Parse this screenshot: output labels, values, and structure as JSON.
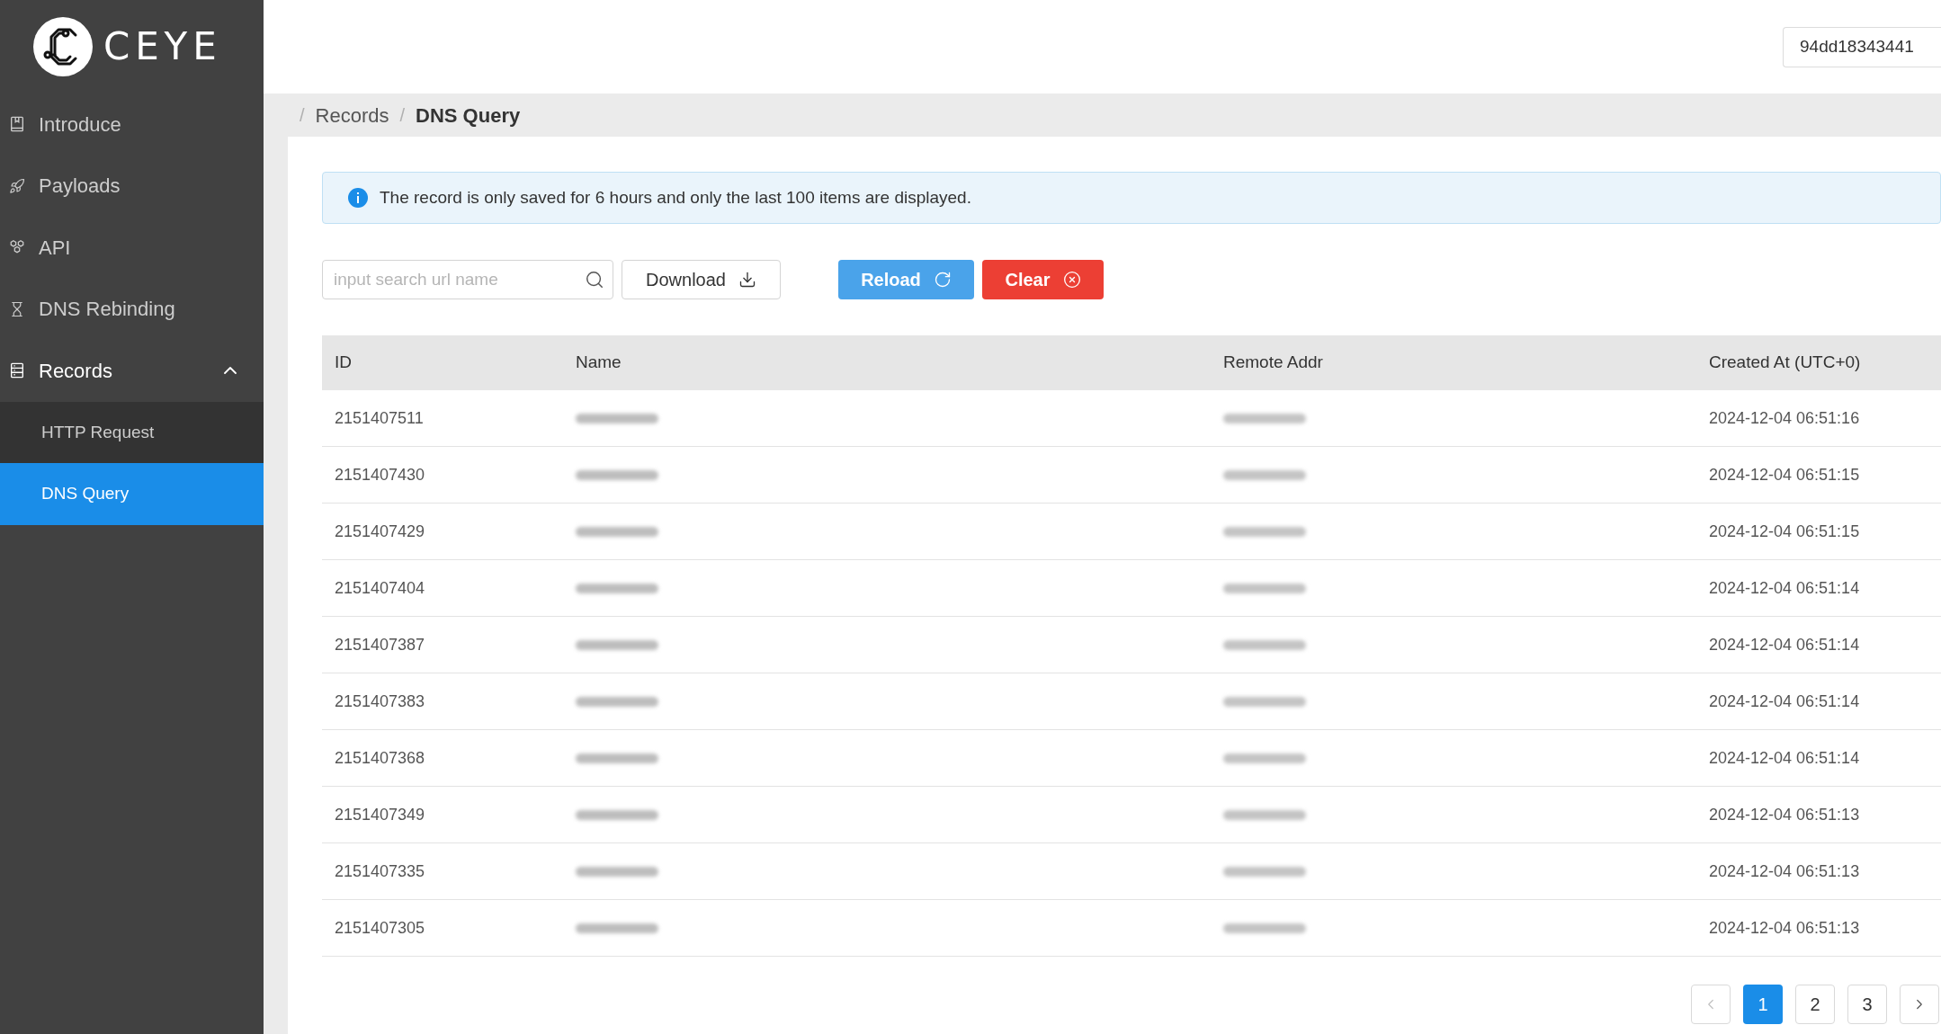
{
  "sidebar": {
    "logo_text": "CEYE",
    "items": [
      {
        "label": "Introduce",
        "selected": false
      },
      {
        "label": "Payloads",
        "selected": false
      },
      {
        "label": "API",
        "selected": false
      },
      {
        "label": "DNS Rebinding",
        "selected": false
      },
      {
        "label": "Records",
        "selected": false,
        "expanded": true,
        "children": [
          {
            "label": "HTTP Request",
            "selected": false
          },
          {
            "label": "DNS Query",
            "selected": true
          }
        ]
      }
    ]
  },
  "header": {
    "account": "94dd18343441"
  },
  "breadcrumb": [
    {
      "separator": "/",
      "label": "Records"
    },
    {
      "separator": "/",
      "label": "DNS Query"
    }
  ],
  "alert": {
    "text": "The record is only saved for 6 hours and only the last 100 items are displayed."
  },
  "toolbar": {
    "search": {
      "placeholder": "input search url name"
    },
    "buttons": [
      {
        "label": "Download",
        "kind": "default"
      },
      {
        "label": "Reload",
        "kind": "primary"
      },
      {
        "label": "Clear",
        "kind": "danger"
      }
    ]
  },
  "table": {
    "columns": [
      "ID",
      "Name",
      "Remote Addr",
      "Created At (UTC+0)"
    ],
    "rows": [
      {
        "id": "2151407511",
        "name_redacted": true,
        "addr_redacted": true,
        "created_at": "2024-12-04 06:51:16"
      },
      {
        "id": "2151407430",
        "name_redacted": true,
        "addr_redacted": true,
        "created_at": "2024-12-04 06:51:15"
      },
      {
        "id": "2151407429",
        "name_redacted": true,
        "addr_redacted": true,
        "created_at": "2024-12-04 06:51:15"
      },
      {
        "id": "2151407404",
        "name_redacted": true,
        "addr_redacted": true,
        "created_at": "2024-12-04 06:51:14"
      },
      {
        "id": "2151407387",
        "name_redacted": true,
        "addr_redacted": true,
        "created_at": "2024-12-04 06:51:14"
      },
      {
        "id": "2151407383",
        "name_redacted": true,
        "addr_redacted": true,
        "created_at": "2024-12-04 06:51:14"
      },
      {
        "id": "2151407368",
        "name_redacted": true,
        "addr_redacted": true,
        "created_at": "2024-12-04 06:51:14"
      },
      {
        "id": "2151407349",
        "name_redacted": true,
        "addr_redacted": true,
        "created_at": "2024-12-04 06:51:13"
      },
      {
        "id": "2151407335",
        "name_redacted": true,
        "addr_redacted": true,
        "created_at": "2024-12-04 06:51:13"
      },
      {
        "id": "2151407305",
        "name_redacted": true,
        "addr_redacted": true,
        "created_at": "2024-12-04 06:51:13"
      }
    ]
  },
  "pagination": {
    "prev": {
      "disabled": true
    },
    "pages": [
      {
        "label": "1",
        "selected": true
      },
      {
        "label": "2",
        "selected": false
      },
      {
        "label": "3",
        "selected": false
      }
    ],
    "next": {
      "disabled": false
    }
  }
}
